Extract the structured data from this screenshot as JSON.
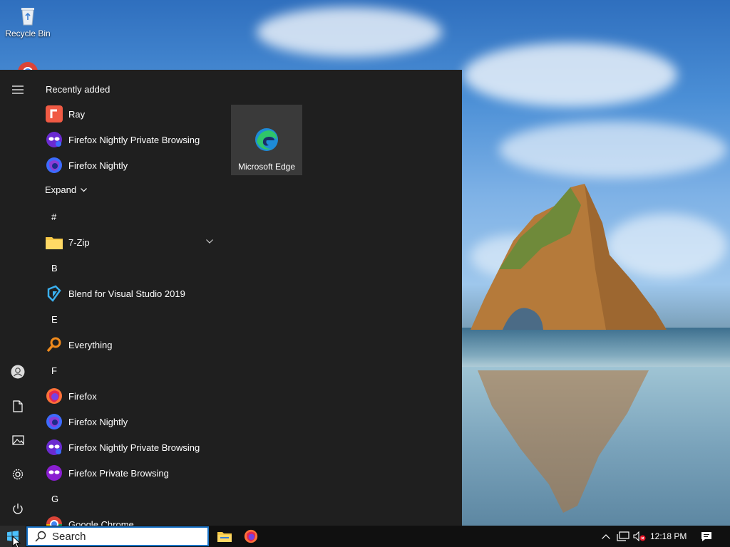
{
  "desktop": {
    "icons": [
      {
        "label": "Recycle Bin",
        "icon": "recycle-bin-icon"
      }
    ]
  },
  "start_menu": {
    "recently_added_header": "Recently added",
    "recent": [
      {
        "label": "Ray",
        "icon": "ray-icon",
        "color": "#e8503a"
      },
      {
        "label": "Firefox Nightly Private Browsing",
        "icon": "firefox-nightly-private-icon",
        "color": "#7b2fd0"
      },
      {
        "label": "Firefox Nightly",
        "icon": "firefox-nightly-icon",
        "color": "#3d6bff"
      }
    ],
    "expand_label": "Expand",
    "sections": [
      {
        "letter": "#",
        "items": [
          {
            "label": "7-Zip",
            "icon": "folder-icon",
            "has_chevron": true
          }
        ]
      },
      {
        "letter": "B",
        "items": [
          {
            "label": "Blend for Visual Studio 2019",
            "icon": "blend-icon"
          }
        ]
      },
      {
        "letter": "E",
        "items": [
          {
            "label": "Everything",
            "icon": "everything-search-icon"
          }
        ]
      },
      {
        "letter": "F",
        "items": [
          {
            "label": "Firefox",
            "icon": "firefox-icon"
          },
          {
            "label": "Firefox Nightly",
            "icon": "firefox-nightly-icon"
          },
          {
            "label": "Firefox Nightly Private Browsing",
            "icon": "firefox-nightly-private-icon"
          },
          {
            "label": "Firefox Private Browsing",
            "icon": "firefox-private-icon"
          }
        ]
      },
      {
        "letter": "G",
        "items": [
          {
            "label": "Google Chrome",
            "icon": "chrome-icon"
          }
        ]
      }
    ],
    "tile": {
      "label": "Microsoft Edge",
      "icon": "edge-icon"
    },
    "rail": [
      "menu-icon",
      "user-icon",
      "documents-icon",
      "pictures-icon",
      "settings-icon",
      "power-icon"
    ]
  },
  "taskbar": {
    "search_placeholder": "Search",
    "apps": [
      "file-explorer-icon",
      "firefox-icon"
    ],
    "tray": [
      "chevron-up-icon",
      "network-icon",
      "volume-muted-icon"
    ],
    "clock": "12:18 PM",
    "notifications_icon": "action-center-icon"
  },
  "colors": {
    "menu_bg": "#1f1f1f",
    "tile_bg": "#3a3a3a",
    "taskbar_bg": "#101010",
    "accent": "#1a73c6"
  }
}
